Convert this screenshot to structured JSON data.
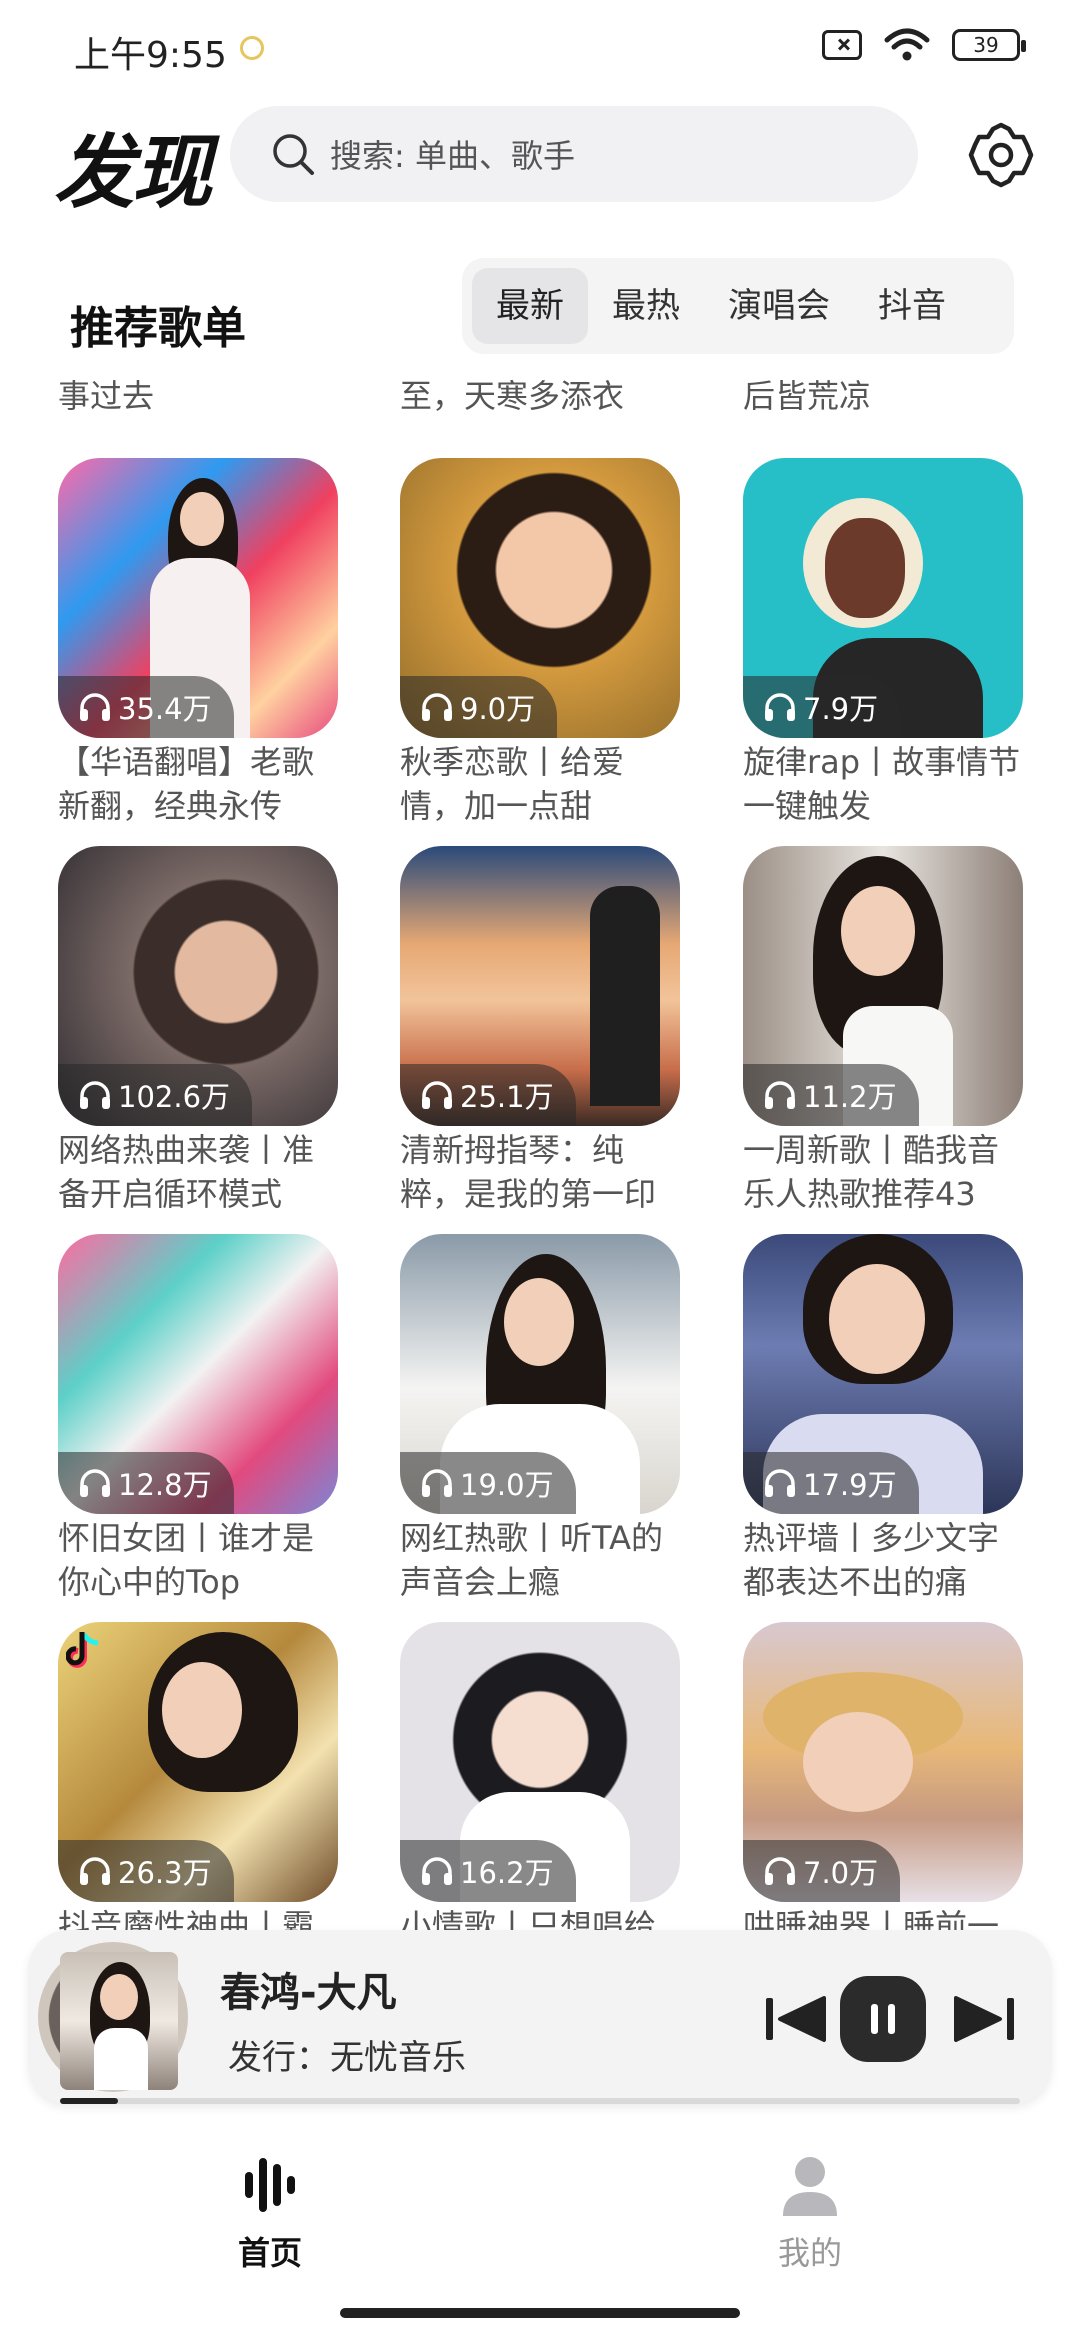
{
  "status_bar": {
    "time": "上午9:55",
    "battery": "39"
  },
  "header": {
    "title": "发现",
    "search_placeholder": "搜索: 单曲、歌手",
    "settings_icon": "gear-icon"
  },
  "section": {
    "title": "推荐歌单",
    "tabs": [
      "最新",
      "最热",
      "演唱会",
      "抖音"
    ],
    "active_tab": "最新"
  },
  "cut_top_titles": [
    "事过去",
    "至，天寒多添衣",
    "后皆荒凉"
  ],
  "playlists": [
    {
      "plays": "35.4万",
      "title": "【华语翻唱】老歌新翻，经典永传"
    },
    {
      "plays": "9.0万",
      "title": "秋季恋歌丨给爱情，加一点甜"
    },
    {
      "plays": "7.9万",
      "title": "旋律rap丨故事情节一键触发"
    },
    {
      "plays": "102.6万",
      "title": "网络热曲来袭丨准备开启循环模式"
    },
    {
      "plays": "25.1万",
      "title": "清新拇指琴：纯粹，是我的第一印"
    },
    {
      "plays": "11.2万",
      "title": "一周新歌丨酷我音乐人热歌推荐43"
    },
    {
      "plays": "12.8万",
      "title": "怀旧女团丨谁才是你心中的Top"
    },
    {
      "plays": "19.0万",
      "title": "网红热歌丨听TA的声音会上瘾"
    },
    {
      "plays": "17.9万",
      "title": "热评墙丨多少文字都表达不出的痛"
    },
    {
      "plays": "26.3万",
      "title": "抖音魔性神曲丨霸"
    },
    {
      "plays": "16.2万",
      "title": "小情歌丨只想唱给"
    },
    {
      "plays": "7.0万",
      "title": "哄睡神器丨睡前一"
    }
  ],
  "player": {
    "song": "春鸿-大凡",
    "label": "发行：无忧音乐",
    "progress": 0.06
  },
  "nav": {
    "home": "首页",
    "mine": "我的"
  }
}
